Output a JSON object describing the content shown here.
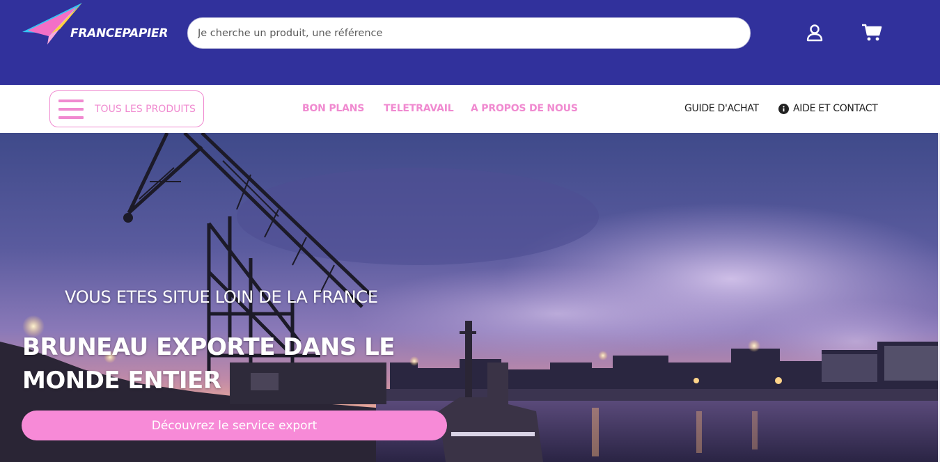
{
  "header": {
    "logo_text": "FRANCEPAPIER",
    "search": {
      "placeholder": "Je cherche un produit, une référence",
      "value": ""
    },
    "icons": {
      "account": "user-icon",
      "cart": "shopping-cart-icon"
    },
    "colors": {
      "background": "#31319c",
      "logo_pink": "#f36fc6",
      "logo_cyan": "#34c6f4"
    }
  },
  "nav": {
    "all_products_label": "TOUS LES PRODUITS",
    "links": [
      "BON PLANS",
      "TELETRAVAIL",
      "A PROPOS DE NOUS"
    ],
    "guide_label": "GUIDE D'ACHAT",
    "help_label": "AIDE ET CONTACT",
    "colors": {
      "accent": "#f08ad0"
    }
  },
  "hero": {
    "kicker": "VOUS ETES SITUE LOIN DE LA FRANCE",
    "title": "BRUNEAU EXPORTE DANS LE MONDE ENTIER",
    "cta_label": "Découvrez le service export",
    "colors": {
      "cta": "#f78ad7"
    }
  }
}
